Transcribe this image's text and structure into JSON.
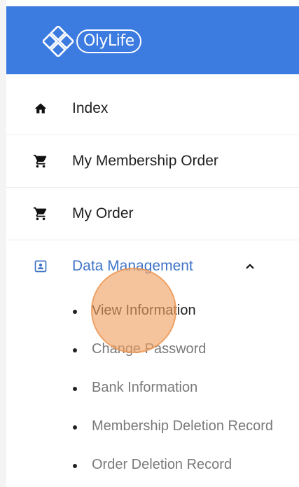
{
  "header": {
    "logo_text": "OlyLife",
    "color": "#3c7be0"
  },
  "menu": {
    "items": [
      {
        "label": "Index",
        "icon": "home-icon"
      },
      {
        "label": "My Membership Order",
        "icon": "cart-icon"
      },
      {
        "label": "My Order",
        "icon": "cart-icon"
      },
      {
        "label": "Data Management",
        "icon": "id-card-icon",
        "expanded": true,
        "active_color": "#3f73c6"
      }
    ],
    "chevron": "^"
  },
  "submenu": {
    "items": [
      {
        "label": "View Information"
      },
      {
        "label": "Change Password"
      },
      {
        "label": "Bank Information"
      },
      {
        "label": "Membership Deletion Record"
      },
      {
        "label": "Order Deletion Record"
      }
    ]
  }
}
